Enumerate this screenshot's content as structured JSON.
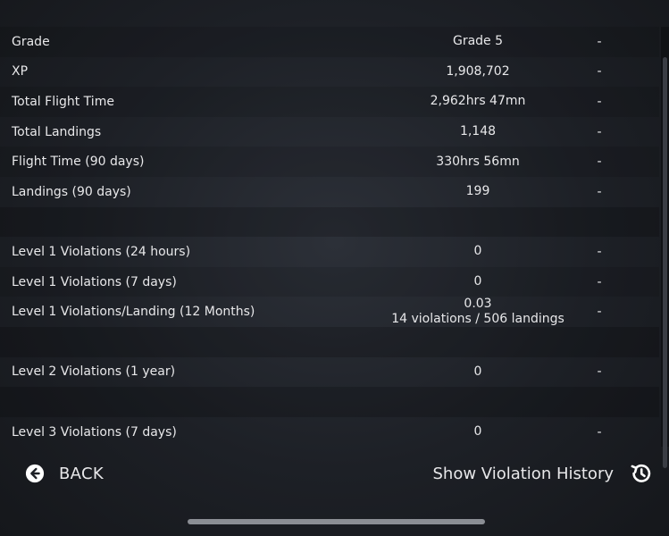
{
  "stats": [
    {
      "label": "Grade",
      "value": "Grade 5",
      "extra": "-"
    },
    {
      "label": "XP",
      "value": "1,908,702",
      "extra": "-"
    },
    {
      "label": "Total Flight Time",
      "value": "2,962hrs 47mn",
      "extra": "-"
    },
    {
      "label": "Total Landings",
      "value": "1,148",
      "extra": "-"
    },
    {
      "label": "Flight Time (90 days)",
      "value": "330hrs 56mn",
      "extra": "-"
    },
    {
      "label": "Landings (90 days)",
      "value": "199",
      "extra": "-"
    },
    {
      "label": "Level 1 Violations (24 hours)",
      "value": "0",
      "extra": "-"
    },
    {
      "label": "Level 1 Violations (7 days)",
      "value": "0",
      "extra": "-"
    },
    {
      "label": "Level 1 Violations/Landing (12 Months)",
      "value": "0.03",
      "value2": "14 violations / 506 landings",
      "extra": "-"
    },
    {
      "label": "Level 2 Violations (1 year)",
      "value": "0",
      "extra": "-"
    },
    {
      "label": "Level 3 Violations (7 days)",
      "value": "0",
      "extra": "-"
    }
  ],
  "footer": {
    "back_label": "BACK",
    "back_icon": "back-arrow-circle-icon",
    "history_label": "Show Violation History",
    "history_icon": "history-clock-icon"
  },
  "colors": {
    "text": "#e8e8ea",
    "background": "#1d2026"
  }
}
